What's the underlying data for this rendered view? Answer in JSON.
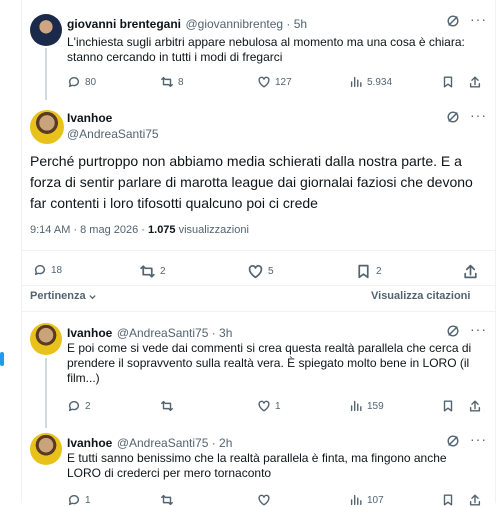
{
  "colors": {
    "text": "#0f1419",
    "muted": "#536471",
    "border": "#eff3f4",
    "accent": "#1d9bf0"
  },
  "tweet1": {
    "name": "giovanni brentegani",
    "handle": "@giovannibrenteg · 5h",
    "text_line1": "L'inchiesta sugli arbitri appare nebulosa al momento ma una cosa è chiara:",
    "text_line2": "stanno cercando in tutti i modi di fregarci",
    "replies": "80",
    "reposts": "8",
    "likes": "127",
    "views": "5.934"
  },
  "main": {
    "name": "Ivanhoe",
    "handle": "@AndreaSanti75",
    "text_line1": "Perché purtroppo non abbiamo media schierati dalla nostra parte. E a",
    "text_line2": "forza di sentir parlare di marotta league dai giornalai faziosi che devono",
    "text_line3": "far contenti i loro tifosotti qualcuno poi ci crede",
    "meta_time": "9:14 AM · 8 mag 2026 ·",
    "meta_views": "1.075",
    "meta_views_label": "visualizzazioni",
    "replies": "18",
    "reposts": "2",
    "likes": "5",
    "bookmarks": "2"
  },
  "sort": {
    "left": "Pertinenza",
    "right": "Visualizza citazioni"
  },
  "reply1": {
    "name": "Ivanhoe",
    "handle": "@AndreaSanti75 · 3h",
    "text_line1": "E poi come si vede dai commenti si crea questa realtà parallela che cerca di",
    "text_line2": "prendere il sopravvento sulla realtà vera. È spiegato molto bene in LORO (il",
    "text_line3": "film...)",
    "replies": "2",
    "reposts": "",
    "likes": "1",
    "views": "159"
  },
  "reply2": {
    "name": "Ivanhoe",
    "handle": "@AndreaSanti75 · 2h",
    "text_line1": "E tutti sanno benissimo che la realtà parallela è finta, ma fingono anche",
    "text_line2": "LORO di crederci per mero tornaconto",
    "replies": "1",
    "reposts": "",
    "likes": "",
    "views": "107"
  },
  "icons": [
    "grok-icon",
    "more-icon",
    "reply-icon",
    "repost-icon",
    "like-icon",
    "views-icon",
    "bookmark-icon",
    "share-icon",
    "chevron-down-icon"
  ]
}
